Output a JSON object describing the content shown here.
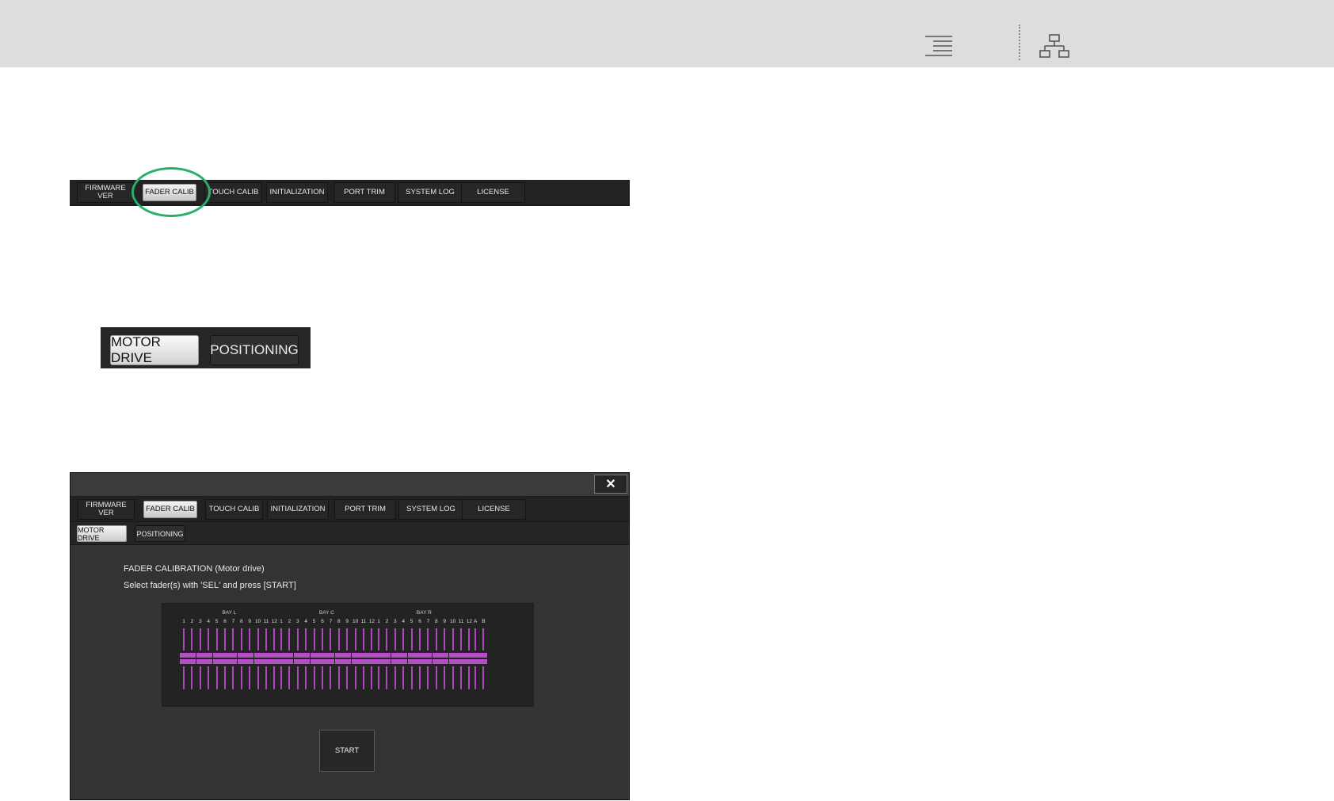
{
  "tabs": [
    {
      "label": "FIRMWARE\nVER",
      "active": false
    },
    {
      "label": "FADER CALIB",
      "active": true
    },
    {
      "label": "TOUCH CALIB",
      "active": false
    },
    {
      "label": "INITIALIZATION",
      "active": false
    },
    {
      "label": "PORT TRIM",
      "active": false
    },
    {
      "label": "SYSTEM LOG",
      "active": false
    },
    {
      "label": "LICENSE",
      "active": false
    }
  ],
  "subtabs": {
    "motor_drive": "MOTOR DRIVE",
    "positioning": "POSITIONING",
    "selected": "MOTOR DRIVE"
  },
  "window": {
    "close_symbol": "✕",
    "title": "FADER CALIBRATION (Motor drive)",
    "instruction": "Select fader(s) with 'SEL' and press [START]",
    "start_label": "START"
  },
  "fader_panel": {
    "bays": [
      {
        "label": "BAY L",
        "channels": [
          "1",
          "2",
          "3",
          "4",
          "5",
          "6",
          "7",
          "8",
          "9",
          "10",
          "11",
          "12"
        ]
      },
      {
        "label": "BAY C",
        "channels": [
          "1",
          "2",
          "3",
          "4",
          "5",
          "6",
          "7",
          "8",
          "9",
          "10",
          "11",
          "12"
        ]
      },
      {
        "label": "BAY R",
        "channels": [
          "1",
          "2",
          "3",
          "4",
          "5",
          "6",
          "7",
          "8",
          "9",
          "10",
          "11",
          "12"
        ]
      },
      {
        "label": "",
        "channels": [
          "A",
          "B"
        ]
      }
    ],
    "fader_color": "#b64fc6"
  },
  "icons": {
    "toc": "table-of-contents-icon",
    "tree": "sitemap-icon"
  },
  "colors": {
    "highlight_ring": "#2bae6a",
    "header_bg": "#dcdddf"
  }
}
